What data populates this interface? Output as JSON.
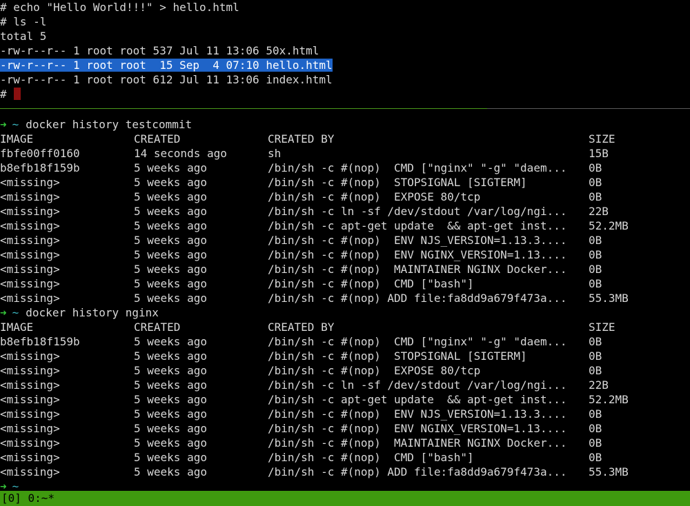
{
  "colors": {
    "background": "#000000",
    "text": "#d8d8d8",
    "selection": "#1f64c8",
    "prompt_arrow": "#35c43a",
    "prompt_tilde": "#3bb6c0",
    "cursor": "#8a1010",
    "status_bar": "#3f9a0f"
  },
  "top_pane": {
    "lines": [
      "# echo \"Hello World!!!\" > hello.html",
      "# ls -l",
      "total 5",
      "-rw-r--r-- 1 root root 537 Jul 11 13:06 50x.html",
      "-rw-r--r-- 1 root root  15 Sep  4 07:10 hello.html",
      "-rw-r--r-- 1 root root 612 Jul 11 13:06 index.html"
    ],
    "final_prompt": "#"
  },
  "bottom_pane": {
    "prompt_arrow": "➜",
    "prompt_tilde": "~",
    "history1": {
      "command": "docker history testcommit",
      "headers": [
        "IMAGE",
        "CREATED",
        "CREATED BY",
        "SIZE"
      ],
      "rows": [
        [
          "fbfe00ff0160",
          "14 seconds ago",
          "sh",
          "15B"
        ],
        [
          "b8efb18f159b",
          "5 weeks ago",
          "/bin/sh -c #(nop)  CMD [\"nginx\" \"-g\" \"daem...",
          "0B"
        ],
        [
          "<missing>",
          "5 weeks ago",
          "/bin/sh -c #(nop)  STOPSIGNAL [SIGTERM]",
          "0B"
        ],
        [
          "<missing>",
          "5 weeks ago",
          "/bin/sh -c #(nop)  EXPOSE 80/tcp",
          "0B"
        ],
        [
          "<missing>",
          "5 weeks ago",
          "/bin/sh -c ln -sf /dev/stdout /var/log/ngi...",
          "22B"
        ],
        [
          "<missing>",
          "5 weeks ago",
          "/bin/sh -c apt-get update  && apt-get inst...",
          "52.2MB"
        ],
        [
          "<missing>",
          "5 weeks ago",
          "/bin/sh -c #(nop)  ENV NJS_VERSION=1.13.3....",
          "0B"
        ],
        [
          "<missing>",
          "5 weeks ago",
          "/bin/sh -c #(nop)  ENV NGINX_VERSION=1.13....",
          "0B"
        ],
        [
          "<missing>",
          "5 weeks ago",
          "/bin/sh -c #(nop)  MAINTAINER NGINX Docker...",
          "0B"
        ],
        [
          "<missing>",
          "5 weeks ago",
          "/bin/sh -c #(nop)  CMD [\"bash\"]",
          "0B"
        ],
        [
          "<missing>",
          "5 weeks ago",
          "/bin/sh -c #(nop) ADD file:fa8dd9a679f473a...",
          "55.3MB"
        ]
      ]
    },
    "history2": {
      "command": "docker history nginx",
      "headers": [
        "IMAGE",
        "CREATED",
        "CREATED BY",
        "SIZE"
      ],
      "rows": [
        [
          "b8efb18f159b",
          "5 weeks ago",
          "/bin/sh -c #(nop)  CMD [\"nginx\" \"-g\" \"daem...",
          "0B"
        ],
        [
          "<missing>",
          "5 weeks ago",
          "/bin/sh -c #(nop)  STOPSIGNAL [SIGTERM]",
          "0B"
        ],
        [
          "<missing>",
          "5 weeks ago",
          "/bin/sh -c #(nop)  EXPOSE 80/tcp",
          "0B"
        ],
        [
          "<missing>",
          "5 weeks ago",
          "/bin/sh -c ln -sf /dev/stdout /var/log/ngi...",
          "22B"
        ],
        [
          "<missing>",
          "5 weeks ago",
          "/bin/sh -c apt-get update  && apt-get inst...",
          "52.2MB"
        ],
        [
          "<missing>",
          "5 weeks ago",
          "/bin/sh -c #(nop)  ENV NJS_VERSION=1.13.3....",
          "0B"
        ],
        [
          "<missing>",
          "5 weeks ago",
          "/bin/sh -c #(nop)  ENV NGINX_VERSION=1.13....",
          "0B"
        ],
        [
          "<missing>",
          "5 weeks ago",
          "/bin/sh -c #(nop)  MAINTAINER NGINX Docker...",
          "0B"
        ],
        [
          "<missing>",
          "5 weeks ago",
          "/bin/sh -c #(nop)  CMD [\"bash\"]",
          "0B"
        ],
        [
          "<missing>",
          "5 weeks ago",
          "/bin/sh -c #(nop) ADD file:fa8dd9a679f473a...",
          "55.3MB"
        ]
      ]
    }
  },
  "status_bar": {
    "text": "[0] 0:~*"
  }
}
